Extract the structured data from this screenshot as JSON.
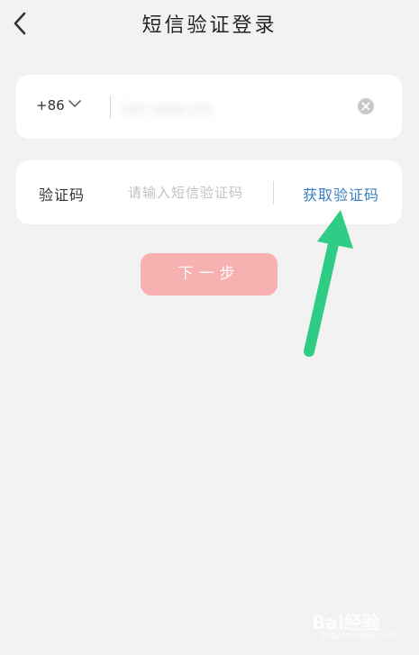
{
  "header": {
    "title": "短信验证登录",
    "back_icon": "chevron-left-icon"
  },
  "phone": {
    "country_code": "+86",
    "country_dropdown_icon": "chevron-down-icon",
    "number_value": "1xx xxxx xxxx",
    "clear_icon": "close-circle-icon"
  },
  "verification": {
    "label": "验证码",
    "placeholder": "请输入短信验证码",
    "get_code_label": "获取验证码"
  },
  "actions": {
    "next_label": "下一步"
  },
  "annotation": {
    "arrow_color": "#2ecc84"
  },
  "watermark": {
    "logo": "Bai经验",
    "sub": "jingyan.baidu.com"
  },
  "colors": {
    "background": "#f2f2f2",
    "card": "#ffffff",
    "link": "#3a7fbf",
    "next_button": "#f7b1b1"
  }
}
